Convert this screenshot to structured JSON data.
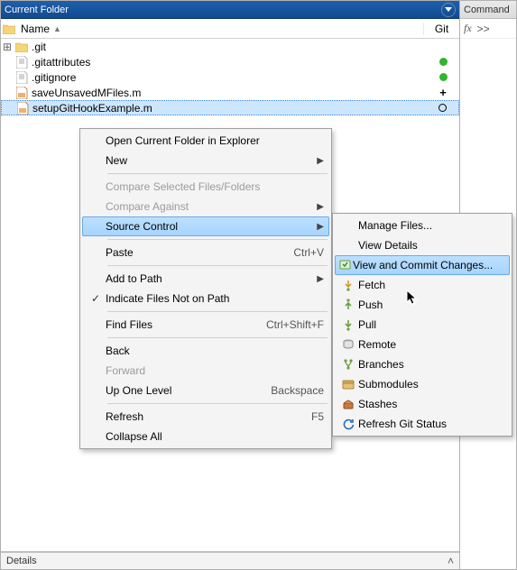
{
  "panel": {
    "title": "Current Folder",
    "details_label": "Details"
  },
  "columns": {
    "name": "Name",
    "git": "Git"
  },
  "files": [
    {
      "name": ".git",
      "type": "folder",
      "status": "none",
      "expandable": true
    },
    {
      "name": ".gitattributes",
      "type": "text",
      "status": "green"
    },
    {
      "name": ".gitignore",
      "type": "text",
      "status": "green"
    },
    {
      "name": "saveUnsavedMFiles.m",
      "type": "mfile",
      "status": "plus"
    },
    {
      "name": "setupGitHookExample.m",
      "type": "mfile",
      "status": "circle",
      "selected": true
    }
  ],
  "right_panel": {
    "title": "Command",
    "fx": "fx",
    "prompt": ">>"
  },
  "context_menu": [
    {
      "label": "Open Current Folder in Explorer"
    },
    {
      "label": "New",
      "submenu": true
    },
    {
      "sep": true
    },
    {
      "label": "Compare Selected Files/Folders",
      "disabled": true
    },
    {
      "label": "Compare Against",
      "disabled": true,
      "submenu": true
    },
    {
      "label": "Source Control",
      "submenu": true,
      "highlight": true
    },
    {
      "sep": true
    },
    {
      "label": "Paste",
      "shortcut": "Ctrl+V"
    },
    {
      "sep": true
    },
    {
      "label": "Add to Path",
      "submenu": true
    },
    {
      "label": "Indicate Files Not on Path",
      "checked": true
    },
    {
      "sep": true
    },
    {
      "label": "Find Files",
      "shortcut": "Ctrl+Shift+F"
    },
    {
      "sep": true
    },
    {
      "label": "Back"
    },
    {
      "label": "Forward",
      "disabled": true
    },
    {
      "label": "Up One Level",
      "shortcut": "Backspace"
    },
    {
      "sep": true
    },
    {
      "label": "Refresh",
      "shortcut": "F5"
    },
    {
      "label": "Collapse All"
    }
  ],
  "source_control_menu": [
    {
      "label": "Manage Files...",
      "icon": "none"
    },
    {
      "label": "View Details",
      "icon": "none"
    },
    {
      "label": "View and Commit Changes...",
      "icon": "commit",
      "highlight": true
    },
    {
      "label": "Fetch",
      "icon": "fetch"
    },
    {
      "label": "Push",
      "icon": "push"
    },
    {
      "label": "Pull",
      "icon": "pull"
    },
    {
      "label": "Remote",
      "icon": "remote"
    },
    {
      "label": "Branches",
      "icon": "branches"
    },
    {
      "label": "Submodules",
      "icon": "submodules"
    },
    {
      "label": "Stashes",
      "icon": "stashes"
    },
    {
      "label": "Refresh Git Status",
      "icon": "refresh"
    }
  ]
}
